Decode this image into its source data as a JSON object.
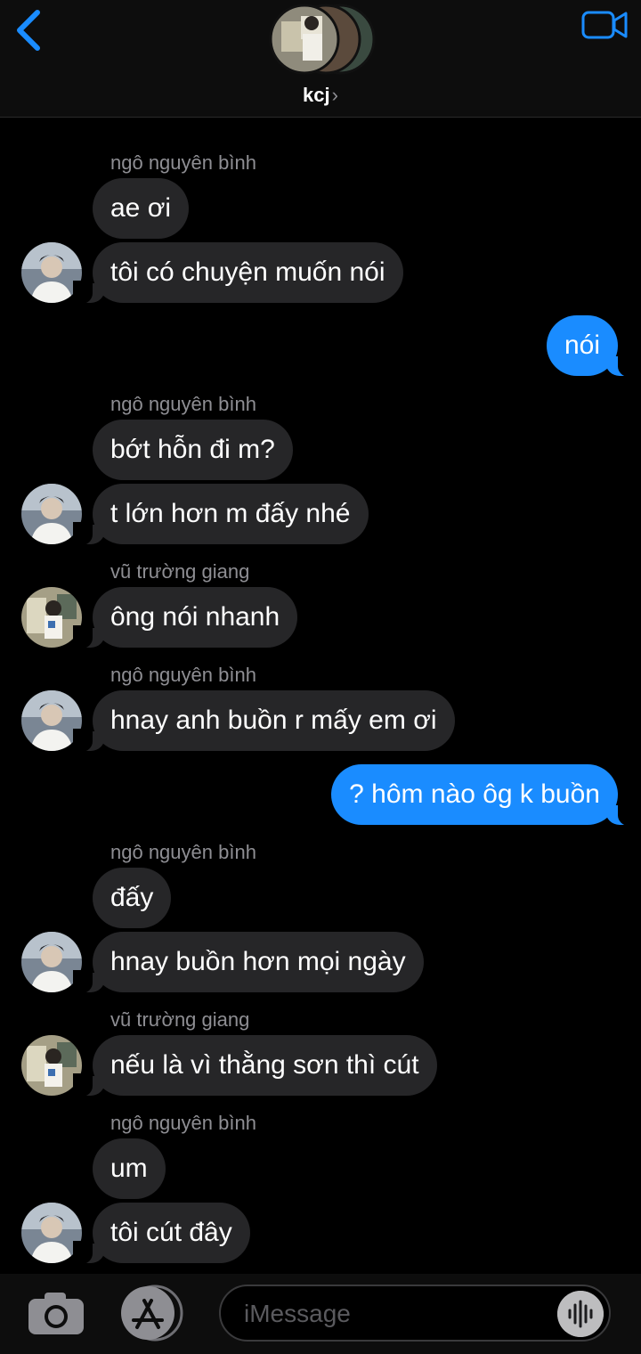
{
  "header": {
    "title": "kcj",
    "chevron": "›",
    "icons": {
      "back": "chevron-left-icon",
      "video": "video-camera-icon"
    }
  },
  "messages": [
    {
      "type": "in",
      "sender": "ngô nguyên bình",
      "text": "ae ơi"
    },
    {
      "type": "in",
      "text": "tôi có chuyện muốn nói"
    },
    {
      "type": "out",
      "text": "nói"
    },
    {
      "type": "in",
      "sender": "ngô nguyên bình",
      "text": "bớt hỗn đi m?"
    },
    {
      "type": "in",
      "text": "t lớn hơn m đấy nhé"
    },
    {
      "type": "in",
      "sender": "vũ trường giang",
      "text": "ông nói nhanh"
    },
    {
      "type": "in",
      "sender": "ngô nguyên bình",
      "text": "hnay anh buồn r mấy em ơi"
    },
    {
      "type": "out",
      "text": "? hôm nào ôg k buồn"
    },
    {
      "type": "in",
      "sender": "ngô nguyên bình",
      "text": "đấy"
    },
    {
      "type": "in",
      "text": "hnay buồn hơn mọi ngày"
    },
    {
      "type": "in",
      "sender": "vũ trường giang",
      "text": "nếu là vì thằng sơn thì cút"
    },
    {
      "type": "in",
      "sender": "ngô nguyên bình",
      "text": "um"
    },
    {
      "type": "in",
      "text": "tôi cút đây"
    }
  ],
  "composer": {
    "placeholder": "iMessage",
    "icons": {
      "camera": "camera-icon",
      "apps": "app-store-icon",
      "audio": "audio-waveform-icon"
    }
  },
  "colors": {
    "accent": "#1a8cff",
    "incoming": "#262628",
    "background": "#000000"
  }
}
